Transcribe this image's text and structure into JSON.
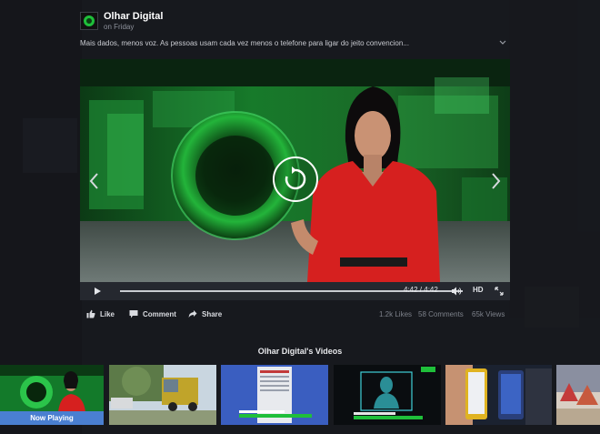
{
  "post": {
    "page_name": "Olhar Digital",
    "time": "on Friday",
    "text": "Mais dados, menos voz. As pessoas usam cada vez menos o telefone para ligar do jeito convencion..."
  },
  "player": {
    "time": "4:42 / 4:42",
    "quality": "HD",
    "progress": 1.0
  },
  "actions": {
    "like": "Like",
    "comment": "Comment",
    "share": "Share"
  },
  "stats": {
    "likes": "1.2k Likes",
    "comments": "58 Comments",
    "views": "65k Views"
  },
  "strip": {
    "title": "Olhar Digital's Videos",
    "now_playing": "Now Playing"
  },
  "colors": {
    "accent_green": "#1fbf3a",
    "now_playing_blue": "#4a7fd1",
    "shirt_red": "#d6201f"
  }
}
